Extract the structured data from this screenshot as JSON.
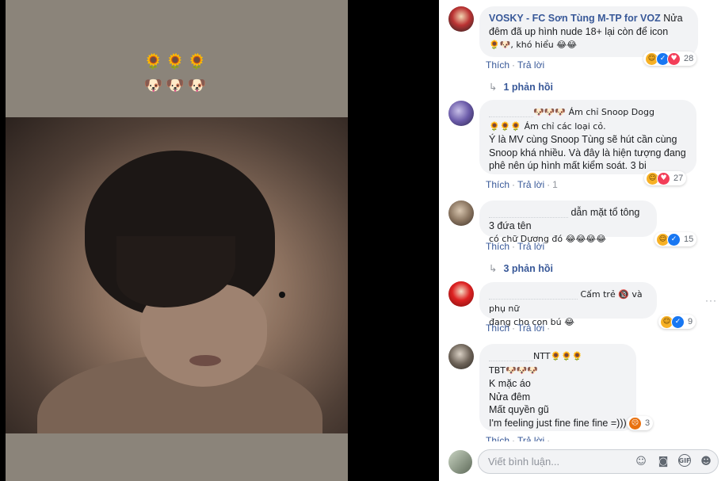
{
  "photo": {
    "caption_line1": "🌻🌻🌻",
    "caption_line2": "🐶🐶🐶"
  },
  "comments": [
    {
      "author": "VOSKY - FC Sơn Tùng M-TP for VOZ",
      "text": "Nửa đêm đã up hình nude 18+ lại còn để icon",
      "text2": "🌻🐶, khó hiểu 😂😂",
      "like": "Thích",
      "reply": "Trả lời",
      "reactions": "28",
      "replies_label": "1 phản hồi"
    },
    {
      "author": "",
      "text": "🐶🐶🐶 Ám chỉ Snoop Dogg",
      "text2": "🌻🌻🌻 Ám chỉ các loại cỏ.",
      "text3": "Ý là MV cùng Snoop Tùng sẽ hút cần cùng Snoop khá nhiều. Và đây là hiện tượng đang phê nên úp hình mất kiểm soát. 3 bi",
      "like": "Thích",
      "reply": "Trả lời",
      "extra": "1",
      "reactions": "27"
    },
    {
      "author": "",
      "text": "dẫn mặt tổ tông 3 đứa tên",
      "text2": "có chữ Dương đó 😂😂😂😂",
      "like": "Thích",
      "reply": "Trả lời",
      "reactions": "15",
      "replies_label": "3 phản hồi"
    },
    {
      "author": "",
      "text": "Cấm trẻ 🔞 và phụ nữ",
      "text2": "đang cho con bú 😂",
      "like": "Thích",
      "reply": "Trả lời",
      "reactions": "9"
    },
    {
      "author": "",
      "text": "NTT🌻🌻🌻",
      "lines": [
        "TBT🐶🐶🐶",
        "K mặc áo",
        "Nửa đêm",
        "Mất quyền gũ",
        "I'm feeling just fine fine fine =)))"
      ],
      "like": "Thích",
      "reply": "Trả lời",
      "reactions": "3"
    }
  ],
  "composer": {
    "placeholder": "Viết bình luận..."
  },
  "colors": {
    "link": "#385898",
    "bubble": "#f2f3f5",
    "muted": "#90949c"
  }
}
